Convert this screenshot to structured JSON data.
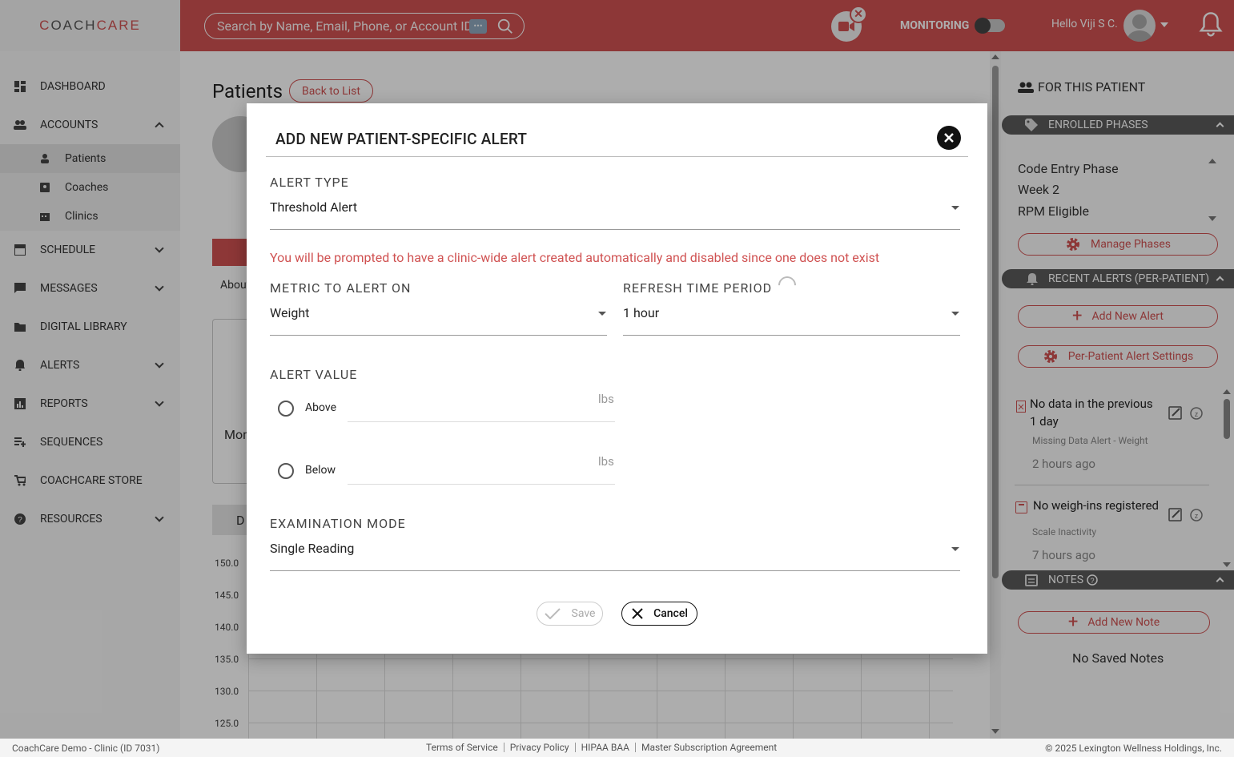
{
  "header": {
    "logo_left": "C",
    "logo_mid": "OACH",
    "logo_right": "CARE",
    "search_placeholder": "Search by Name, Email, Phone, or Account ID",
    "search_dots": "•••",
    "monitoring_label": "MONITORING",
    "greeting": "Hello Viji S C.",
    "cam_close": "✕"
  },
  "sidebar": {
    "items": [
      {
        "label": "DASHBOARD"
      },
      {
        "label": "ACCOUNTS"
      },
      {
        "label": "Patients"
      },
      {
        "label": "Coaches"
      },
      {
        "label": "Clinics"
      },
      {
        "label": "SCHEDULE"
      },
      {
        "label": "MESSAGES"
      },
      {
        "label": "DIGITAL LIBRARY"
      },
      {
        "label": "ALERTS"
      },
      {
        "label": "REPORTS"
      },
      {
        "label": "SEQUENCES"
      },
      {
        "label": "COACHCARE STORE"
      },
      {
        "label": "RESOURCES"
      }
    ]
  },
  "main": {
    "title": "Patients",
    "back_button": "Back to List",
    "about_tab": "About",
    "card_text": "Mon",
    "data_tab": "D",
    "y_ticks": [
      "150.0",
      "145.0",
      "140.0",
      "135.0",
      "130.0",
      "125.0"
    ]
  },
  "modal": {
    "title": "ADD NEW PATIENT-SPECIFIC ALERT",
    "alert_type_label": "ALERT TYPE",
    "alert_type_value": "Threshold Alert",
    "warning": "You will be prompted to have a clinic-wide alert created automatically and disabled since one does not exist",
    "metric_label": "METRIC TO ALERT ON",
    "metric_value": "Weight",
    "refresh_label": "REFRESH TIME PERIOD",
    "refresh_value": "1 hour",
    "alert_value_label": "ALERT VALUE",
    "above_label": "Above",
    "below_label": "Below",
    "unit": "lbs",
    "exam_label": "EXAMINATION MODE",
    "exam_value": "Single Reading",
    "save_label": "Save",
    "cancel_label": "Cancel"
  },
  "right_panel": {
    "header": "FOR THIS PATIENT",
    "enrolled_label": "ENROLLED PHASES",
    "phases": [
      "Code Entry Phase",
      "Week 2",
      "RPM Eligible"
    ],
    "manage_phases": "Manage Phases",
    "recent_alerts_label": "RECENT ALERTS (PER-PATIENT)",
    "add_alert": "Add New Alert",
    "per_patient_settings": "Per-Patient Alert Settings",
    "alerts": [
      {
        "title_line1": "No data in the previous",
        "title_line2": "1 day",
        "type": "Missing Data Alert - Weight",
        "time": "2 hours ago"
      },
      {
        "title_line1": "No weigh-ins registered",
        "title_line2": "",
        "type": "Scale Inactivity",
        "time": "7 hours ago"
      }
    ],
    "notes_label": "NOTES",
    "add_note": "Add New Note",
    "no_notes": "No Saved Notes"
  },
  "footer": {
    "clinic": "CoachCare Demo - Clinic (ID 7031)",
    "links": [
      "Terms of Service",
      "Privacy Policy",
      "HIPAA BAA",
      "Master Subscription Agreement"
    ],
    "copyright": "© 2025 Lexington Wellness Holdings, Inc."
  },
  "colors": {
    "brand": "#d05252",
    "dark_bar": "#5a5a5a"
  }
}
